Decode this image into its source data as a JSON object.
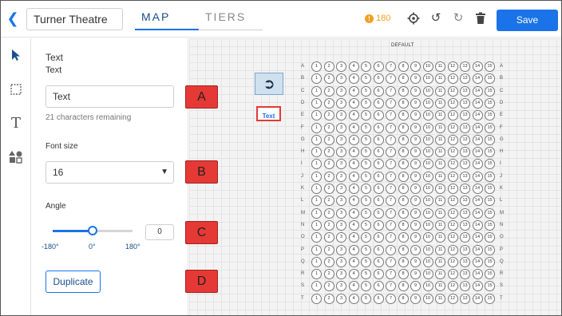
{
  "header": {
    "back_icon": "chevron-left-icon",
    "venue_name": "Turner Theatre",
    "tabs": [
      {
        "label": "MAP",
        "active": true
      },
      {
        "label": "TIERS",
        "active": false
      }
    ],
    "coin_count": "180",
    "save_label": "Save",
    "accent_color": "#1a73e8"
  },
  "toolbar": {
    "tools": [
      "pointer-icon",
      "select-box-icon",
      "text-tool-icon",
      "shapes-icon"
    ]
  },
  "panel": {
    "title": "Text",
    "subtitle": "Text",
    "text_value": "Text",
    "chars_remaining": "21 characters remaining",
    "font_size_label": "Font size",
    "font_size_value": "16",
    "angle_label": "Angle",
    "angle_value": "0",
    "angle_min": "-180°",
    "angle_mid": "0°",
    "angle_max": "180°",
    "duplicate_label": "Duplicate"
  },
  "canvas": {
    "section_name": "DEFAULT",
    "text_object_label": "Text",
    "exit_icon": "exit-icon",
    "rows": [
      "A",
      "B",
      "C",
      "D",
      "E",
      "F",
      "G",
      "H",
      "I",
      "J",
      "K",
      "L",
      "M",
      "N",
      "O",
      "P",
      "Q",
      "R",
      "S",
      "T"
    ],
    "seat_numbers": [
      "1",
      "2",
      "3",
      "4",
      "5",
      "6",
      "7",
      "8",
      "9",
      "10",
      "11",
      "12",
      "13",
      "14",
      "15"
    ]
  },
  "markers": [
    "A",
    "B",
    "C",
    "D"
  ]
}
